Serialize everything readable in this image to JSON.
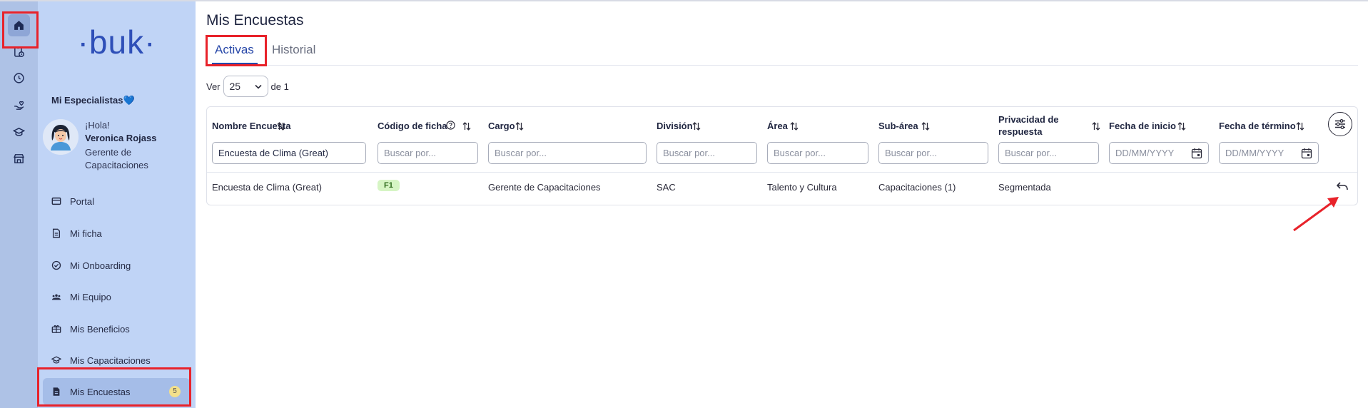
{
  "sidebar": {
    "logo": "·buk·",
    "section_title": "Mi Especialistas",
    "heart": "💙",
    "greeting": "¡Hola!",
    "user_name": "Veronica Rojass",
    "user_role": "Gerente de Capacitaciones",
    "items": [
      {
        "label": "Portal",
        "icon": "portal-icon"
      },
      {
        "label": "Mi ficha",
        "icon": "document-icon"
      },
      {
        "label": "Mi Onboarding",
        "icon": "check-circle-icon"
      },
      {
        "label": "Mi Equipo",
        "icon": "team-icon"
      },
      {
        "label": "Mis Beneficios",
        "icon": "gift-icon"
      },
      {
        "label": "Mis Capacitaciones",
        "icon": "graduation-cap-icon"
      },
      {
        "label": "Mis Encuestas",
        "icon": "survey-icon",
        "badge": "5",
        "active": true
      }
    ]
  },
  "rail": {
    "icons": [
      "home-icon",
      "clipboard-clock-icon",
      "clock-icon",
      "hand-heart-icon",
      "graduation-cap-icon",
      "store-icon"
    ]
  },
  "main": {
    "title": "Mis Encuestas",
    "tabs": [
      {
        "label": "Activas",
        "active": true
      },
      {
        "label": "Historial",
        "active": false
      }
    ],
    "pager": {
      "prefix": "Ver",
      "value": "25",
      "suffix": "de 1"
    }
  },
  "table": {
    "columns": [
      {
        "label": "Nombre Encuesta",
        "filter_value": "Encuesta de Clima (Great)",
        "placeholder": ""
      },
      {
        "label": "Código de ficha",
        "filter_value": "",
        "placeholder": "Buscar por..."
      },
      {
        "label": "Cargo",
        "filter_value": "",
        "placeholder": "Buscar por..."
      },
      {
        "label": "División",
        "filter_value": "",
        "placeholder": "Buscar por..."
      },
      {
        "label": "Área",
        "filter_value": "",
        "placeholder": "Buscar por..."
      },
      {
        "label": "Sub-área",
        "filter_value": "",
        "placeholder": "Buscar por..."
      },
      {
        "label": "Privacidad de respuesta",
        "filter_value": "",
        "placeholder": "Buscar por..."
      },
      {
        "label": "Fecha de inicio",
        "filter_value": "",
        "placeholder": "DD/MM/YYYY"
      },
      {
        "label": "Fecha de término",
        "filter_value": "",
        "placeholder": "DD/MM/YYYY"
      }
    ],
    "rows": [
      {
        "nombre": "Encuesta de Clima (Great)",
        "codigo": "F1",
        "cargo": "Gerente de Capacitaciones",
        "division": "SAC",
        "area": "Talento y Cultura",
        "subarea": "Capacitaciones (1)",
        "privacidad": "Segmentada",
        "inicio": "",
        "termino": ""
      }
    ]
  },
  "colors": {
    "rail_bg": "#aec2e6",
    "sidebar_bg": "#c0d4f6",
    "accent": "#2747a8",
    "annotation": "#e8222a",
    "chip_bg": "#d6f5c4"
  }
}
